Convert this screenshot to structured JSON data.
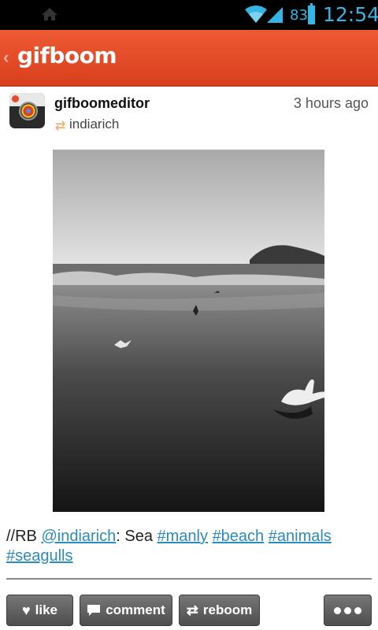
{
  "status_bar": {
    "battery_percent": "83",
    "time": "12:54",
    "icons": [
      "home-icon",
      "wifi-icon",
      "signal-icon",
      "battery-icon"
    ]
  },
  "app_bar": {
    "back_glyph": "‹",
    "logo_text": "gifboom"
  },
  "post": {
    "username": "gifboomeditor",
    "timestamp": "3 hours ago",
    "reboomed_from": "indiarich",
    "caption": {
      "prefix": "//RB ",
      "mention": "@indiarich",
      "mid": ": Sea ",
      "tags": [
        "#manly",
        "#beach",
        "#animals",
        "#seagulls"
      ]
    }
  },
  "actions": {
    "like": "like",
    "comment": "comment",
    "reboom": "reboom"
  },
  "colors": {
    "accent": "#33b5e5",
    "brand": "#e34b26",
    "link": "#2a8bbf"
  }
}
